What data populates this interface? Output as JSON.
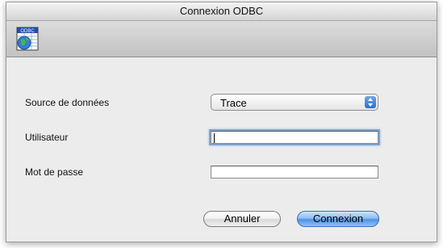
{
  "window": {
    "title": "Connexion ODBC"
  },
  "toolbar": {
    "icon": "database-globe-icon",
    "icon_text": "ODBC"
  },
  "form": {
    "data_source": {
      "label": "Source de données",
      "selected": "Trace"
    },
    "user": {
      "label": "Utilisateur",
      "value": ""
    },
    "password": {
      "label": "Mot de passe",
      "value": ""
    }
  },
  "buttons": {
    "cancel": "Annuler",
    "connect": "Connexion"
  },
  "colors": {
    "accent": "#4f92e6",
    "focus_ring": "#7da2ce"
  }
}
